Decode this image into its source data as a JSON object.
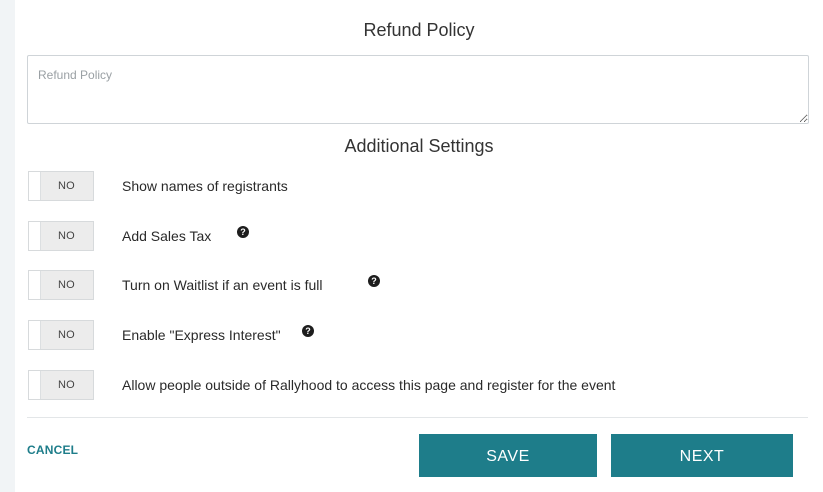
{
  "refund": {
    "title": "Refund Policy",
    "placeholder": "Refund Policy",
    "value": ""
  },
  "additional": {
    "title": "Additional Settings",
    "settings": [
      {
        "toggle": "NO",
        "label": "Show names of registrants"
      },
      {
        "toggle": "NO",
        "label": "Add Sales Tax",
        "help_icon": "question-circle-icon"
      },
      {
        "toggle": "NO",
        "label": "Turn on Waitlist if an event is full",
        "help_icon": "question-circle-icon"
      },
      {
        "toggle": "NO",
        "label": "Enable \"Express Interest\"",
        "help_icon": "question-circle-icon"
      },
      {
        "toggle": "NO",
        "label": "Allow people outside of Rallyhood to access this page and register for the event"
      }
    ]
  },
  "footer": {
    "cancel_label": "CANCEL",
    "save_label": "SAVE",
    "next_label": "NEXT"
  },
  "colors": {
    "accent": "#1e7d8a",
    "background": "#f1f4f6"
  }
}
